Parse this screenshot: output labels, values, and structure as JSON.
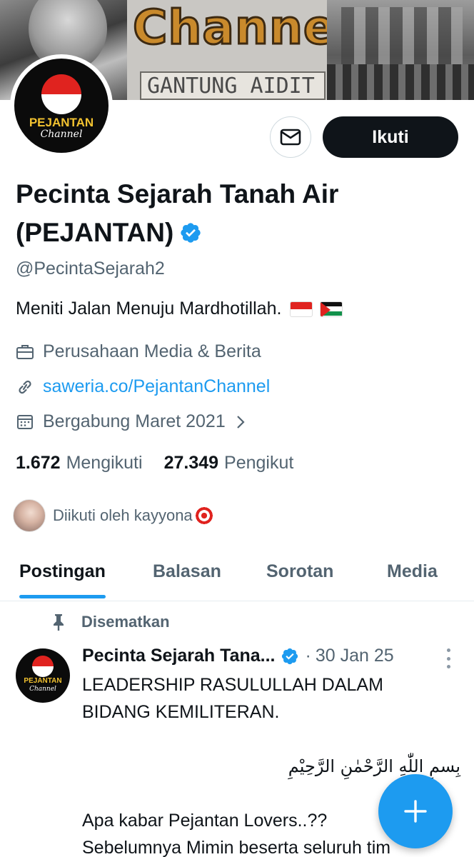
{
  "banner": {
    "channel_title": "Channel",
    "sign_text": "GANTUNG AIDIT"
  },
  "avatar": {
    "brand": "PEJANTAN",
    "script": "Channel"
  },
  "actions": {
    "message_icon": "envelope-icon",
    "follow_label": "Ikuti"
  },
  "profile": {
    "name": "Pecinta Sejarah Tanah Air (PEJANTAN)",
    "handle": "@PecintaSejarah2",
    "bio": "Meniti Jalan Menuju Mardhotillah.",
    "bio_emojis": [
      "indonesia-flag",
      "palestine-flag"
    ],
    "category": "Perusahaan Media & Berita",
    "link": "saweria.co/PejantanChannel",
    "joined": "Bergabung Maret 2021"
  },
  "stats": {
    "following_count": "1.672",
    "following_label": "Mengikuti",
    "followers_count": "27.349",
    "followers_label": "Pengikut"
  },
  "followed_by": {
    "text": "Diikuti oleh kayyona"
  },
  "tabs": [
    {
      "label": "Postingan",
      "active": true
    },
    {
      "label": "Balasan",
      "active": false
    },
    {
      "label": "Sorotan",
      "active": false
    },
    {
      "label": "Media",
      "active": false
    }
  ],
  "pinned_post": {
    "pinned_label": "Disematkan",
    "author": "Pecinta Sejarah Tana...",
    "separator": "·",
    "date": "30 Jan 25",
    "lines": [
      "LEADERSHIP RASULULLAH DALAM",
      "BIDANG KEMILITERAN.",
      "",
      "بِسمِ اللّٰهِ الرَّحْمٰنِ الرَّحِيْمِ",
      "",
      "Apa kabar Pejantan Lovers..??",
      "Sebelumnya Mimin beserta seluruh tim"
    ]
  },
  "colors": {
    "accent": "#1d9bf0",
    "text": "#0f1419",
    "muted": "#536471"
  }
}
